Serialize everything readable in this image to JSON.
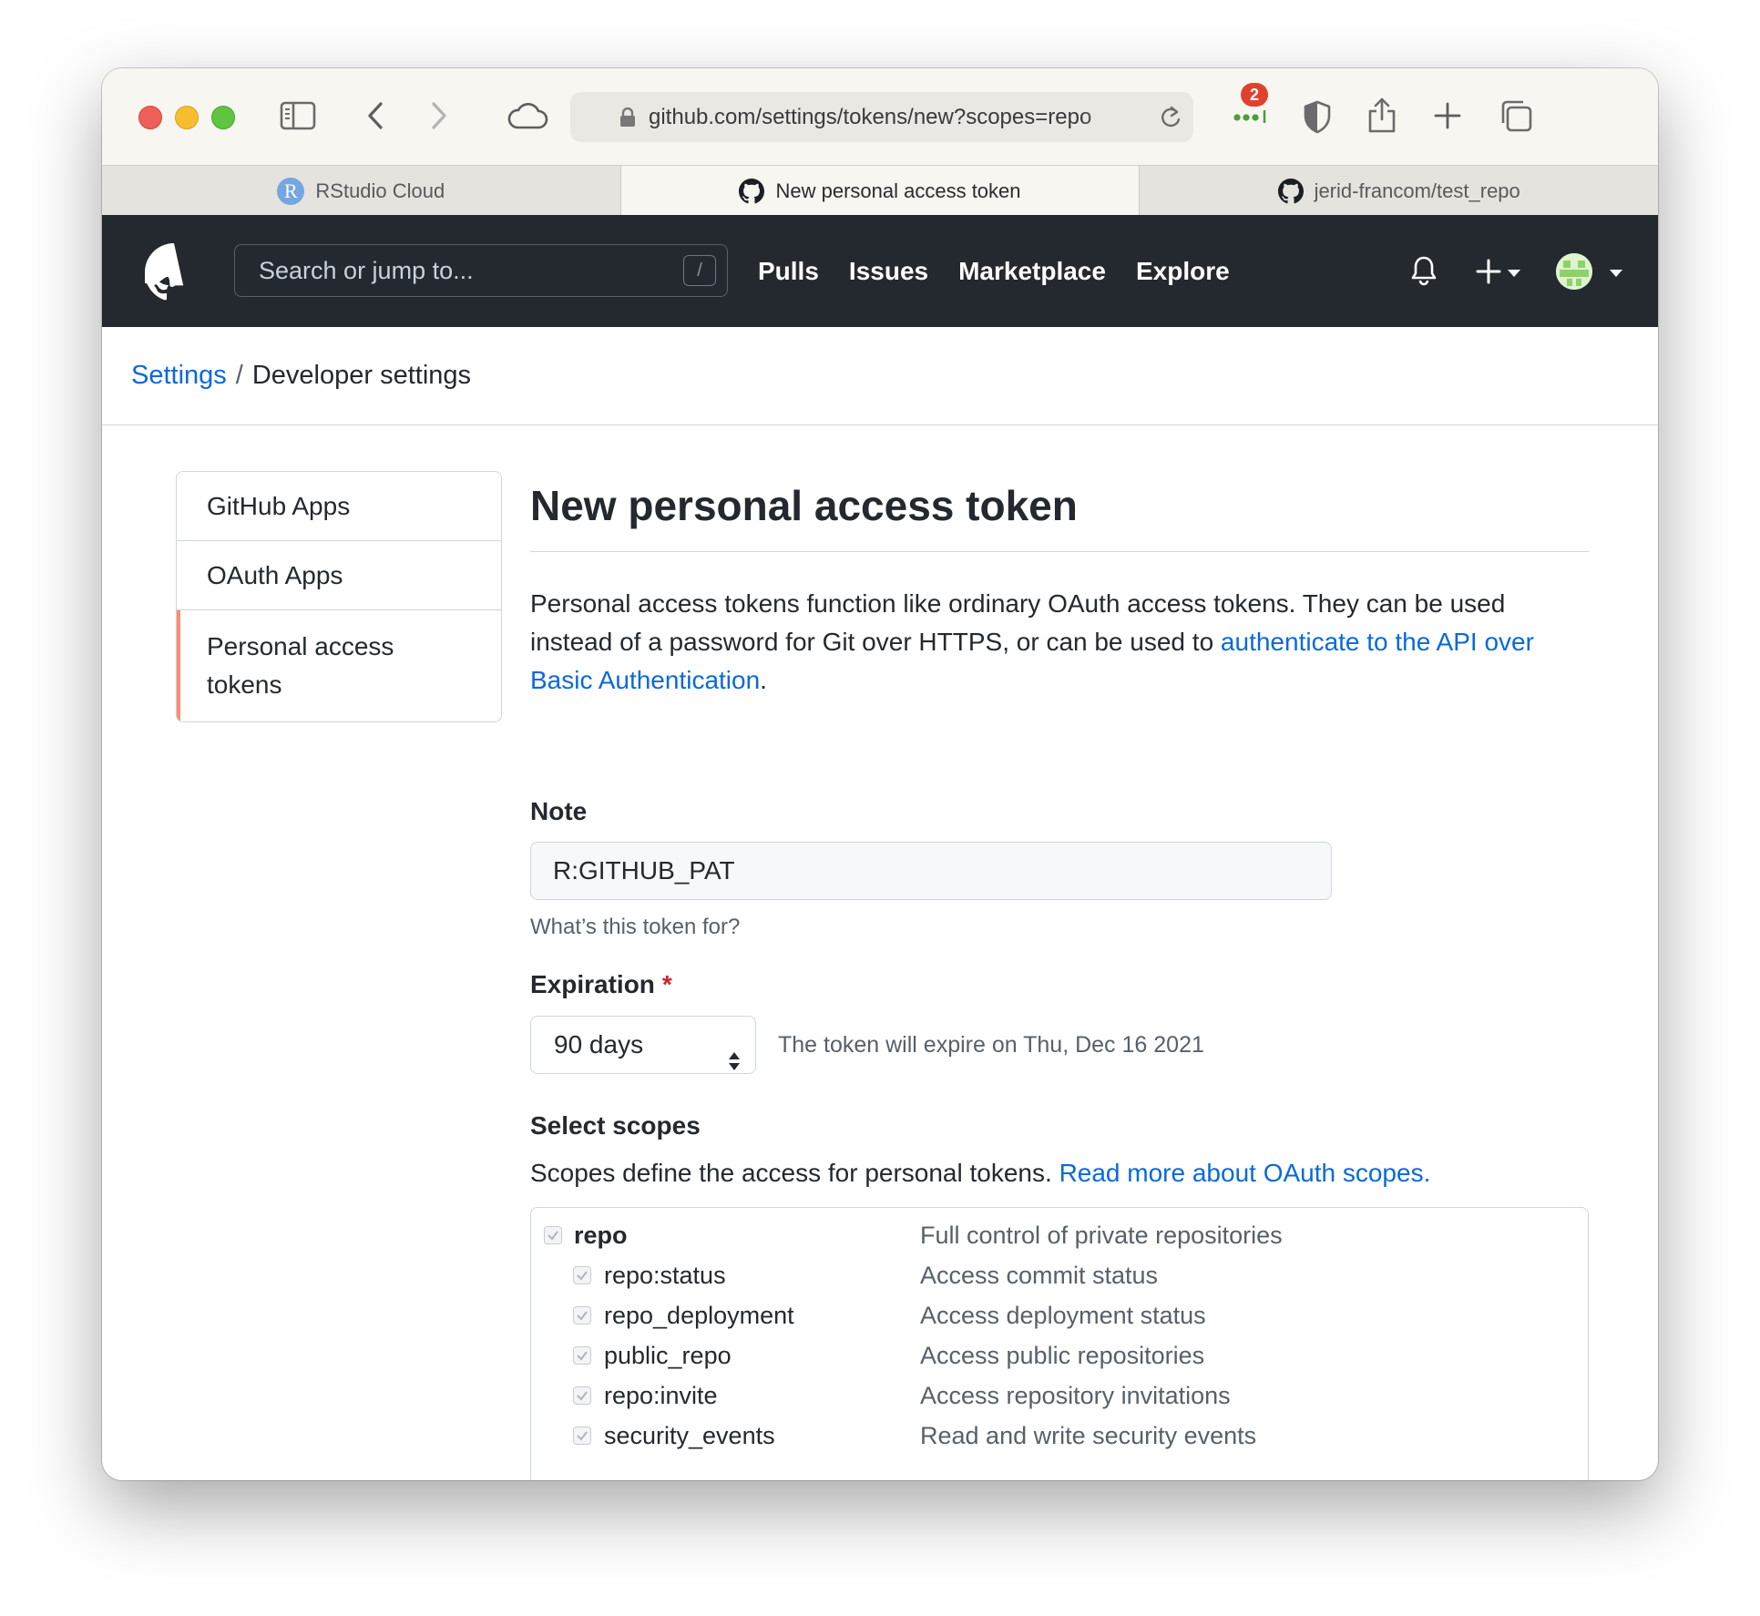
{
  "browser": {
    "url": "github.com/settings/tokens/new?scopes=repo",
    "extension_badge": "2",
    "tabs": [
      {
        "label": "RStudio Cloud",
        "favicon": "R"
      },
      {
        "label": "New personal access token",
        "favicon": "github-icon"
      },
      {
        "label": "jerid-francom/test_repo",
        "favicon": "github-icon"
      }
    ]
  },
  "header": {
    "search_placeholder": "Search or jump to...",
    "search_shortcut": "/",
    "nav": [
      "Pulls",
      "Issues",
      "Marketplace",
      "Explore"
    ]
  },
  "breadcrumb": {
    "settings": "Settings",
    "separator": "/",
    "current": "Developer settings"
  },
  "sidebar": {
    "items": [
      "GitHub Apps",
      "OAuth Apps",
      "Personal access tokens"
    ]
  },
  "main": {
    "title": "New personal access token",
    "intro_text": "Personal access tokens function like ordinary OAuth access tokens. They can be used instead of a password for Git over HTTPS, or can be used to ",
    "intro_link": "authenticate to the API over Basic Authentication",
    "intro_end": ".",
    "note_label": "Note",
    "note_value": "R:GITHUB_PAT",
    "note_help": "What’s this token for?",
    "expiration_label": "Expiration",
    "expiration_required": "*",
    "expiration_value": "90 days",
    "expiration_note": "The token will expire on Thu, Dec 16 2021",
    "scopes_label": "Select scopes",
    "scopes_desc": "Scopes define the access for personal tokens. ",
    "scopes_link": "Read more about OAuth scopes.",
    "scopes": [
      {
        "name": "repo",
        "desc": "Full control of private repositories",
        "checked": true
      },
      {
        "name": "repo:status",
        "desc": "Access commit status",
        "checked": true
      },
      {
        "name": "repo_deployment",
        "desc": "Access deployment status",
        "checked": true
      },
      {
        "name": "public_repo",
        "desc": "Access public repositories",
        "checked": true
      },
      {
        "name": "repo:invite",
        "desc": "Access repository invitations",
        "checked": true
      },
      {
        "name": "security_events",
        "desc": "Read and write security events",
        "checked": true
      }
    ]
  },
  "colors": {
    "header_bg": "#24292f",
    "link": "#0969da",
    "selected_accent": "#fd8c73",
    "required": "#cf222e"
  }
}
